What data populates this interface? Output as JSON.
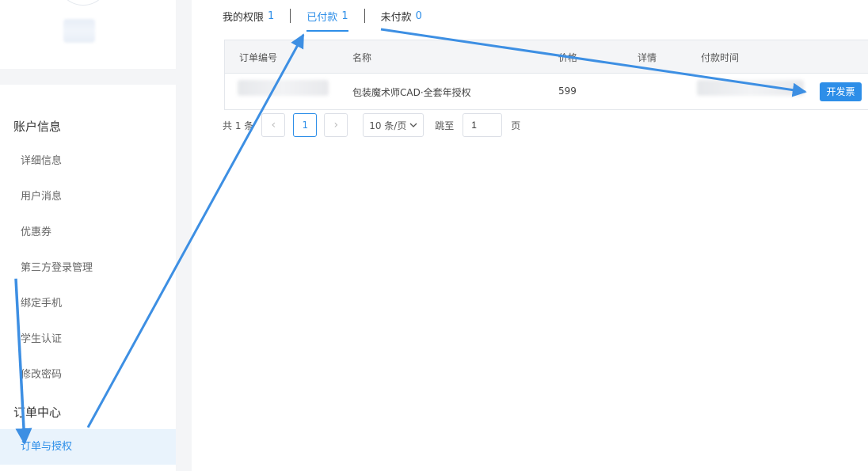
{
  "sidebar": {
    "account_section": "账户信息",
    "order_section": "订单中心",
    "items": [
      {
        "label": "详细信息"
      },
      {
        "label": "用户消息"
      },
      {
        "label": "优惠券"
      },
      {
        "label": "第三方登录管理"
      },
      {
        "label": "绑定手机"
      },
      {
        "label": "学生认证"
      },
      {
        "label": "修改密码"
      }
    ],
    "active_item": {
      "label": "订单与授权"
    }
  },
  "tabs": [
    {
      "label": "我的权限",
      "count": "1"
    },
    {
      "label": "已付款",
      "count": "1",
      "active": true
    },
    {
      "label": "未付款",
      "count": "0"
    }
  ],
  "table": {
    "headers": [
      "订单编号",
      "名称",
      "价格",
      "详情",
      "付款时间"
    ],
    "rows": [
      {
        "order_no": "",
        "name": "包装魔术师CAD·全套年授权",
        "price": "599",
        "detail": "",
        "paid_time": "",
        "action": "开发票"
      }
    ]
  },
  "pagination": {
    "total": "共 1 条",
    "prev": "‹",
    "current_page": "1",
    "next": "›",
    "page_size": "10 条/页",
    "jump_label": "跳至",
    "jump_value": "1",
    "page_unit": "页"
  },
  "colors": {
    "accent": "#2d8ee8",
    "annotation_arrow": "#3d8fe3",
    "sidebar_active_bg": "#e9f3fc"
  }
}
